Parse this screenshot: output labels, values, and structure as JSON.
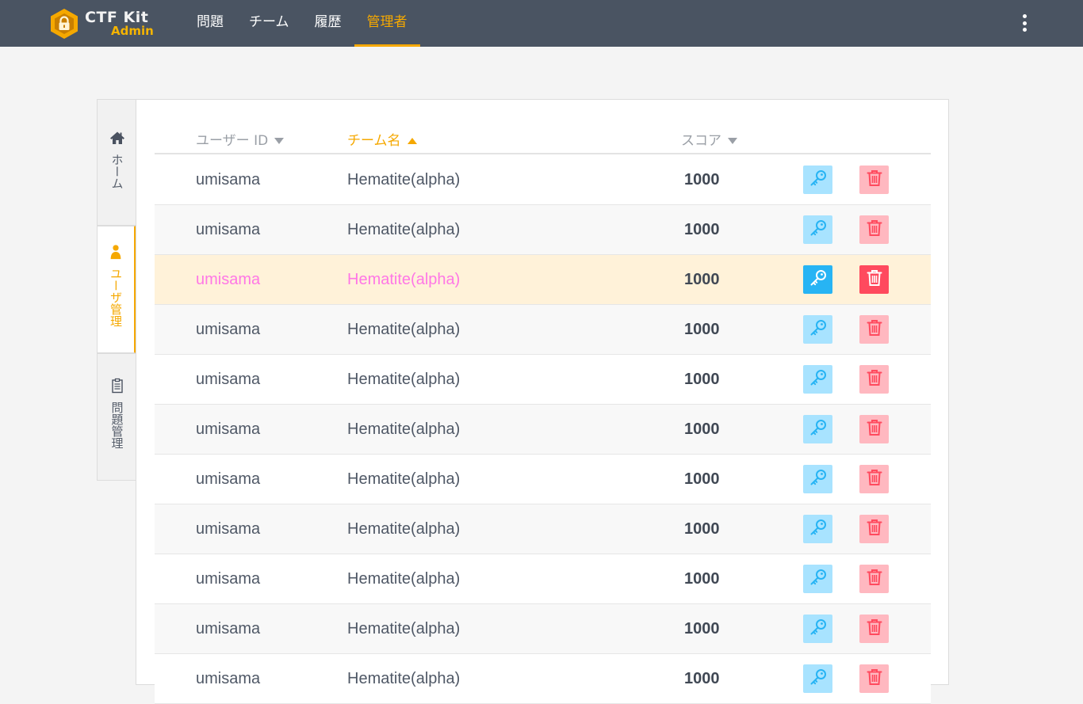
{
  "app": {
    "logo_title": "CTF Kit",
    "logo_subtitle": "Admin"
  },
  "nav": {
    "items": [
      {
        "label": "問題",
        "active": false
      },
      {
        "label": "チーム",
        "active": false
      },
      {
        "label": "履歴",
        "active": false
      },
      {
        "label": "管理者",
        "active": true
      }
    ],
    "menu_icon": "more-vertical-icon"
  },
  "sidebar": {
    "tabs": [
      {
        "label": "ホーム",
        "icon": "home-icon",
        "active": false
      },
      {
        "label": "ユーザ管理",
        "icon": "user-icon",
        "active": true
      },
      {
        "label": "問題管理",
        "icon": "clipboard-icon",
        "active": false
      }
    ]
  },
  "table": {
    "columns": [
      {
        "label": "ユーザー ID",
        "sort": "desc",
        "sorted": false
      },
      {
        "label": "チーム名",
        "sort": "asc",
        "sorted": true
      },
      {
        "label": "スコア",
        "sort": "desc",
        "sorted": false
      }
    ],
    "rows": [
      {
        "user_id": "umisama",
        "team": "Hematite(alpha)",
        "score": "1000"
      },
      {
        "user_id": "umisama",
        "team": "Hematite(alpha)",
        "score": "1000"
      },
      {
        "user_id": "umisama",
        "team": "Hematite(alpha)",
        "score": "1000",
        "hovered": true
      },
      {
        "user_id": "umisama",
        "team": "Hematite(alpha)",
        "score": "1000"
      },
      {
        "user_id": "umisama",
        "team": "Hematite(alpha)",
        "score": "1000"
      },
      {
        "user_id": "umisama",
        "team": "Hematite(alpha)",
        "score": "1000"
      },
      {
        "user_id": "umisama",
        "team": "Hematite(alpha)",
        "score": "1000"
      },
      {
        "user_id": "umisama",
        "team": "Hematite(alpha)",
        "score": "1000"
      },
      {
        "user_id": "umisama",
        "team": "Hematite(alpha)",
        "score": "1000"
      },
      {
        "user_id": "umisama",
        "team": "Hematite(alpha)",
        "score": "1000"
      },
      {
        "user_id": "umisama",
        "team": "Hematite(alpha)",
        "score": "1000"
      }
    ],
    "row_actions": {
      "key_icon": "key-icon",
      "delete_icon": "trash-icon"
    }
  },
  "colors": {
    "header_bg": "#4a5462",
    "accent": "#f5a800",
    "highlight_text": "#ff77e6",
    "key_button": "#a8e3ff",
    "key_button_active": "#27b4f4",
    "delete_button": "#ffb8c0",
    "delete_button_active": "#ff4a5e"
  }
}
